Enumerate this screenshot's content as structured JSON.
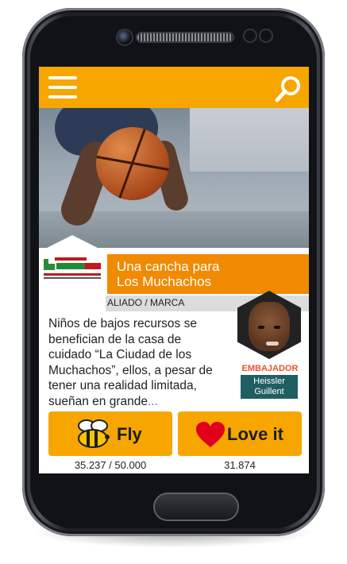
{
  "app": {
    "header": {
      "menu_icon": "hamburger-menu-icon",
      "search_icon": "search-icon"
    },
    "article": {
      "title_line1": "Una cancha para",
      "title_line2": "Los Muchachos",
      "category": "ALIADO / MARCA",
      "description": "Niños de bajos recursos se benefician de la casa de cuidado “La Ciudad de los Muchachos”, ellos, a pesar de tener una realidad limitada, sueñan en grande",
      "more": "..."
    },
    "ambassador": {
      "label": "EMBAJADOR",
      "first_name": "Heissler",
      "last_name": "Guillent"
    },
    "actions": {
      "fly": {
        "label": "Fly",
        "count": "35.237 / 50.000",
        "icon": "bee-icon"
      },
      "love": {
        "label": "Love it",
        "count": "31.874",
        "icon": "heart-icon"
      }
    }
  },
  "colors": {
    "accent": "#f7a600",
    "title_bar": "#f08a00",
    "ambassador_label": "#e8552b",
    "ambassador_name_bg": "#1f5f63",
    "heart": "#e0001b"
  }
}
